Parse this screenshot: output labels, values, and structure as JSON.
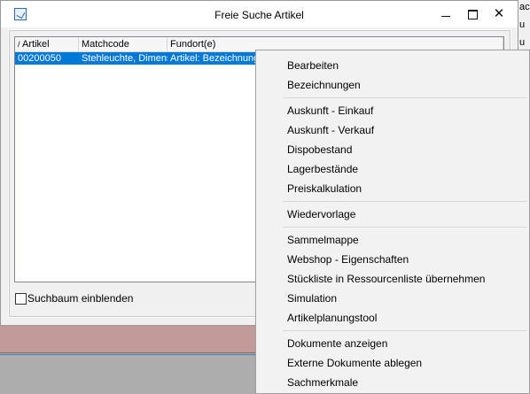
{
  "window": {
    "title": "Freie Suche Artikel"
  },
  "table": {
    "columns": [
      "Artikel",
      "Matchcode",
      "Fundort(e)"
    ],
    "rows": [
      {
        "artikel": "00200050",
        "matchcode": "Stehleuchte, Dimens",
        "fundort": "Artikel: Bezeichnung"
      }
    ]
  },
  "checkbox": {
    "label": "Suchbaum einblenden",
    "checked": false
  },
  "context_menu": {
    "items": [
      "Bearbeiten",
      "Bezeichnungen",
      "Auskunft - Einkauf",
      "Auskunft - Verkauf",
      "Dispobestand",
      "Lagerbestände",
      "Preiskalkulation",
      "Wiedervorlage",
      "Sammelmappe",
      "Webshop - Eigenschaften",
      "Stückliste in Ressourcenliste übernehmen",
      "Simulation",
      "Artikelplanungstool",
      "Dokumente anzeigen",
      "Externe Dokumente ablegen",
      "Sachmerkmale"
    ]
  },
  "background": {
    "fragments": [
      "ach",
      "u",
      "u"
    ]
  },
  "colors": {
    "selection": "#0078d7",
    "menu_bg": "#f2f2f2",
    "window_bg": "#f0f0f0"
  }
}
